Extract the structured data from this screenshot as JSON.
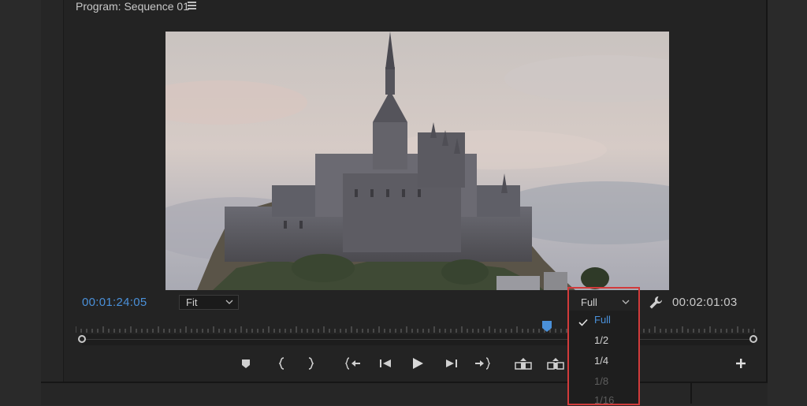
{
  "panel": {
    "title": "Program: Sequence 01",
    "menu_icon": "hamburger-icon"
  },
  "timecode": {
    "current": "00:01:24:05",
    "duration": "00:02:01:03",
    "current_color": "#4a90d9"
  },
  "zoom_select": {
    "value": "Fit"
  },
  "resolution_select": {
    "value": "Full",
    "options": [
      {
        "label": "Full",
        "state": "selected"
      },
      {
        "label": "1/2",
        "state": "enabled"
      },
      {
        "label": "1/4",
        "state": "enabled"
      },
      {
        "label": "1/8",
        "state": "disabled"
      },
      {
        "label": "1/16",
        "state": "disabled"
      }
    ]
  },
  "playhead": {
    "position_fraction": 0.69
  },
  "controls": [
    {
      "name": "add-marker-icon"
    },
    {
      "name": "mark-in-icon"
    },
    {
      "name": "mark-out-icon"
    },
    {
      "name": "go-to-in-icon"
    },
    {
      "name": "step-back-icon"
    },
    {
      "name": "play-icon"
    },
    {
      "name": "step-forward-icon"
    },
    {
      "name": "go-to-out-icon"
    },
    {
      "name": "lift-icon"
    },
    {
      "name": "extract-icon"
    },
    {
      "name": "button-editor-plus-icon"
    }
  ],
  "colors": {
    "accent": "#4a90d9",
    "highlight_border": "#d23b3b",
    "panel_bg": "#232323"
  }
}
